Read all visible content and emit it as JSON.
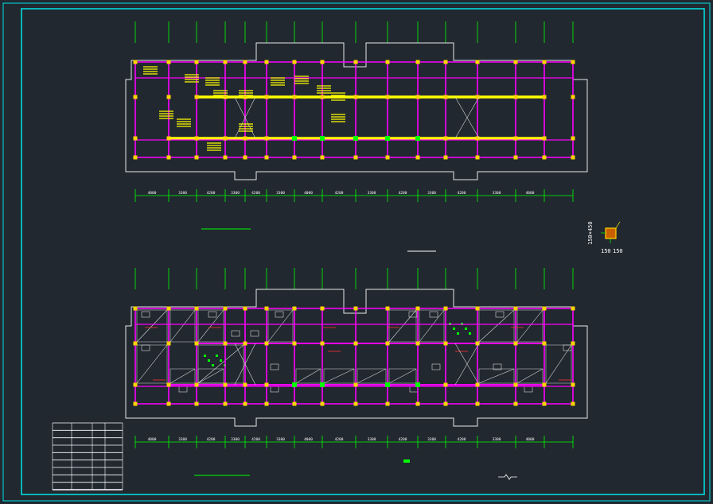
{
  "colors": {
    "background": "#212830",
    "frame": "#00e5e5",
    "wall_outline": "#e8e8e8",
    "beam_magenta": "#ff00ff",
    "beam_yellow": "#ffff00",
    "axis_green": "#00ff00",
    "column_yellow": "#ffd400",
    "hatch_white": "#d8d8d8",
    "arrow_red": "#ff3030"
  },
  "plans": [
    {
      "name": "beam-layout-plan",
      "dimension_labels": [
        "4000",
        "3300",
        "4200",
        "3300",
        "4200",
        "3300",
        "4000",
        "4200",
        "3300",
        "4200",
        "3300",
        "4200",
        "3300",
        "4000"
      ]
    },
    {
      "name": "slab-layout-plan",
      "dimension_labels": [
        "4000",
        "3300",
        "4200",
        "3300",
        "4200",
        "3300",
        "4000",
        "4200",
        "3300",
        "4200",
        "3300",
        "4200",
        "3300",
        "4000"
      ]
    }
  ],
  "section_detail": {
    "label_a": "150×450",
    "label_b": "150",
    "label_c": "150"
  },
  "legend_table": {
    "rows": 9,
    "cols": 4
  },
  "icons": [
    "column-section-icon"
  ]
}
